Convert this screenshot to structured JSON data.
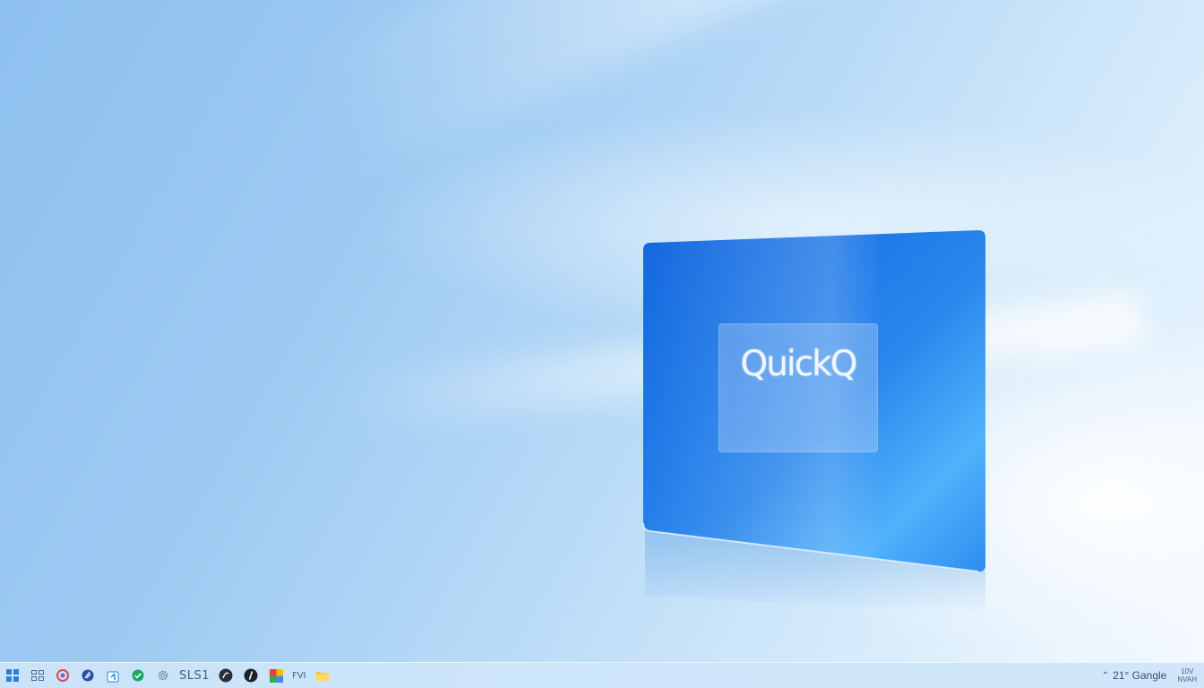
{
  "desktop": {
    "card": {
      "logo_text": "QuickQ",
      "colors": {
        "card_blue": "#1f7ae8",
        "card_light": "#4fb2fb",
        "logo_text": "#f1f7ff"
      }
    },
    "colors": {
      "background": "#a8d0f4",
      "taskbar": "#cee5f8"
    }
  },
  "taskbar": {
    "pinned": [
      {
        "icon": "start-icon"
      },
      {
        "icon": "task-view-icon"
      },
      {
        "icon": "red-circle-app-icon"
      },
      {
        "icon": "blue-circle-app-icon"
      },
      {
        "icon": "store-bag-icon"
      },
      {
        "icon": "green-check-app-icon"
      },
      {
        "icon": "settings-gear-icon"
      },
      {
        "label": "SLS1"
      },
      {
        "icon": "dark-circle-app-icon"
      },
      {
        "icon": "dark-circle-app-2-icon"
      },
      {
        "icon": "chrome-icon"
      },
      {
        "label": "FVI"
      },
      {
        "icon": "file-explorer-icon"
      }
    ],
    "tray": {
      "arrow": "⌃",
      "status_text": "21° Gangle",
      "clock_line1": "10V",
      "clock_line2": "NVAH"
    }
  }
}
